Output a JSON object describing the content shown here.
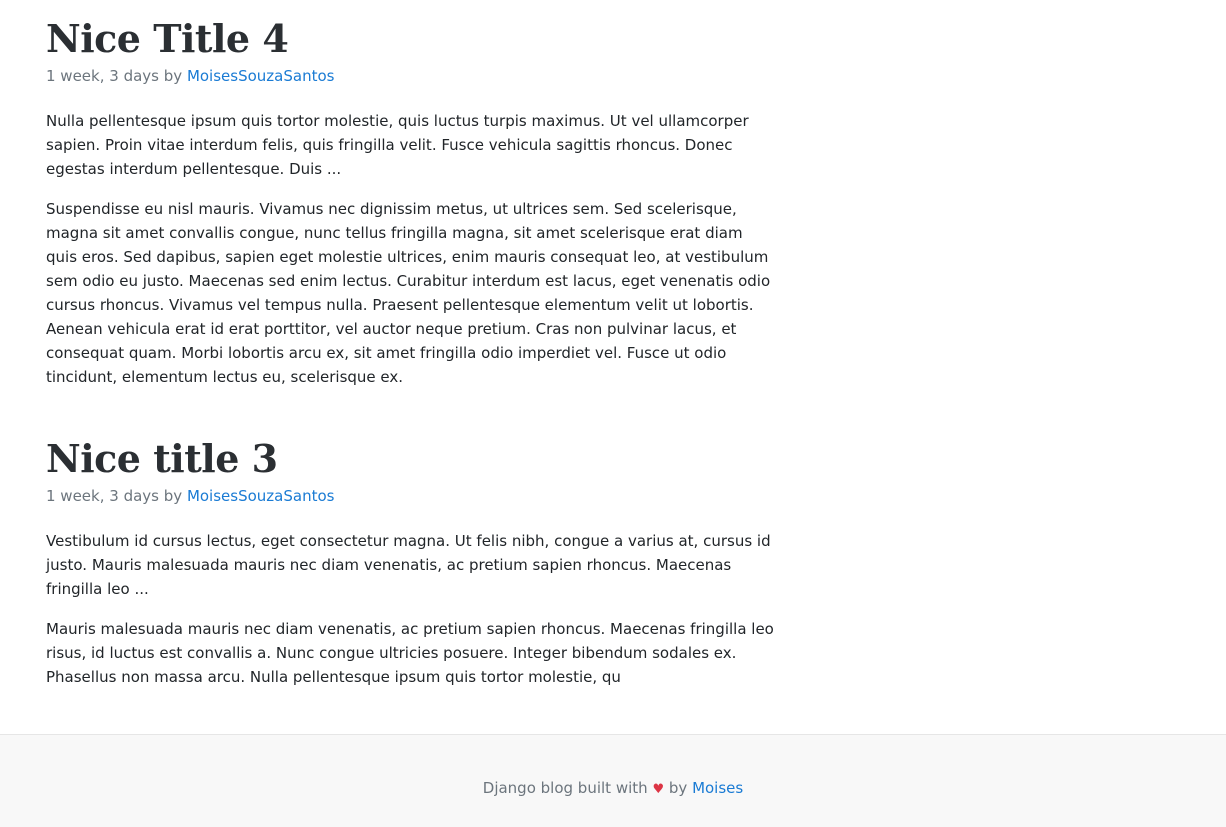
{
  "posts": [
    {
      "title": "Nice Title 4",
      "meta_time": "1 week, 3 days by",
      "author": "MoisesSouzaSantos",
      "excerpt": "Nulla pellentesque ipsum quis tortor molestie, quis luctus turpis maximus. Ut vel ullamcorper sapien. Proin vitae interdum felis, quis fringilla velit. Fusce vehicula sagittis rhoncus. Donec egestas interdum pellentesque. Duis ...",
      "body": "Suspendisse eu nisl mauris. Vivamus nec dignissim metus, ut ultrices sem. Sed scelerisque, magna sit amet convallis congue, nunc tellus fringilla magna, sit amet scelerisque erat diam quis eros. Sed dapibus, sapien eget molestie ultrices, enim mauris consequat leo, at vestibulum sem odio eu justo. Maecenas sed enim lectus. Curabitur interdum est lacus, eget venenatis odio cursus rhoncus. Vivamus vel tempus nulla. Praesent pellentesque elementum velit ut lobortis. Aenean vehicula erat id erat porttitor, vel auctor neque pretium. Cras non pulvinar lacus, et consequat quam. Morbi lobortis arcu ex, sit amet fringilla odio imperdiet vel. Fusce ut odio tincidunt, elementum lectus eu, scelerisque ex."
    },
    {
      "title": "Nice title 3",
      "meta_time": "1 week, 3 days by",
      "author": "MoisesSouzaSantos",
      "excerpt": "Vestibulum id cursus lectus, eget consectetur magna. Ut felis nibh, congue a varius at, cursus id justo. Mauris malesuada mauris nec diam venenatis, ac pretium sapien rhoncus. Maecenas fringilla leo ...",
      "body": "Mauris malesuada mauris nec diam venenatis, ac pretium sapien rhoncus. Maecenas fringilla leo risus, id luctus est convallis a. Nunc congue ultricies posuere. Integer bibendum sodales ex. Phasellus non massa arcu. Nulla pellentesque ipsum quis tortor molestie, qu"
    }
  ],
  "footer": {
    "prefix": "Django blog built with",
    "heart": "♥",
    "by": "by",
    "author_link": "Moises"
  },
  "colors": {
    "link": "#1a7bd4",
    "heart": "#dc3545",
    "footer_bg": "#f8f8f8"
  }
}
